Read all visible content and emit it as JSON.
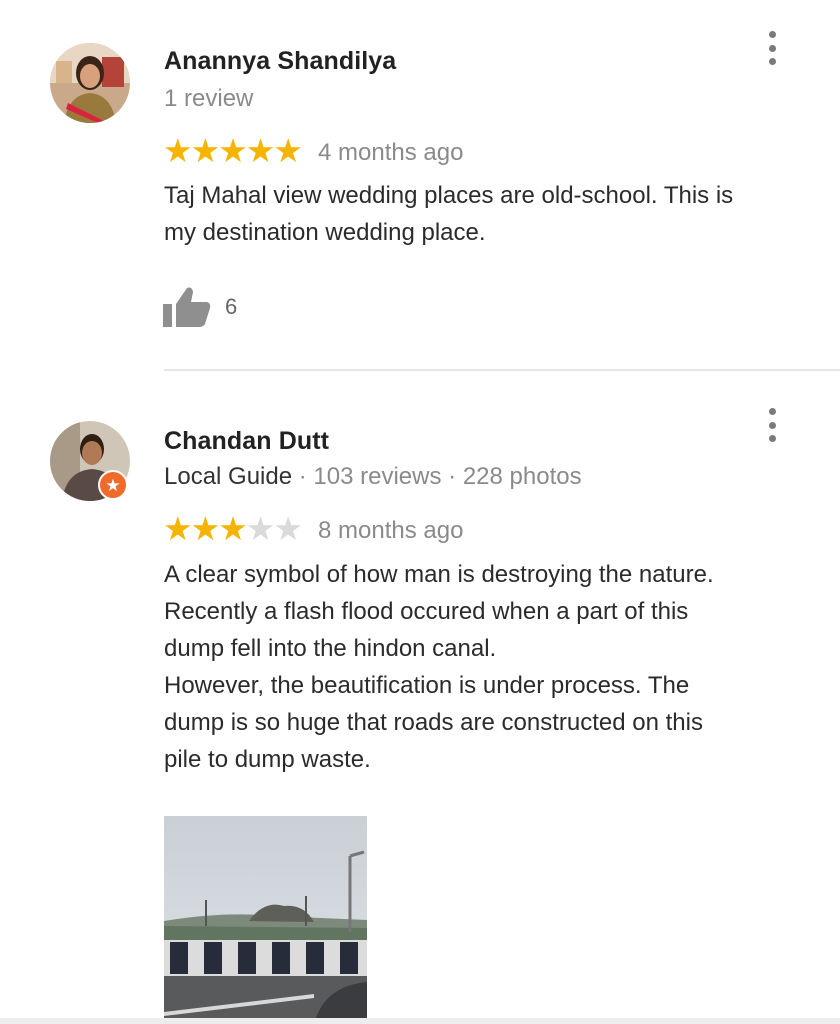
{
  "reviews": [
    {
      "author": "Anannya Shandilya",
      "reviews_count": "1 review",
      "rating": 5,
      "time": "4 months ago",
      "text": "Taj Mahal view wedding places are old-school. This is\nmy destination wedding place.",
      "likes": "6",
      "icons": {
        "avatar": "avatar-photo",
        "menu": "more-vert-icon",
        "like": "thumbs-up-icon"
      }
    },
    {
      "author": "Chandan Dutt",
      "guide_label": "Local Guide",
      "reviews_count": "103 reviews",
      "photos_count": "228 photos",
      "rating": 3,
      "time": "8 months ago",
      "text": "A clear symbol of how man is destroying the nature.\nRecently a flash flood occured when a part of this\ndump fell into the hindon canal.\nHowever, the beautification is under process. The\ndump is so huge that roads are constructed on this\npile to dump waste.",
      "icons": {
        "avatar": "avatar-photo",
        "badge": "local-guide-badge-icon",
        "menu": "more-vert-icon",
        "photo": "review-photo"
      }
    }
  ],
  "separator": " · ",
  "colors": {
    "star_on": "#f5b400",
    "star_off": "#dadada",
    "guide_badge": "#f06a2a"
  }
}
